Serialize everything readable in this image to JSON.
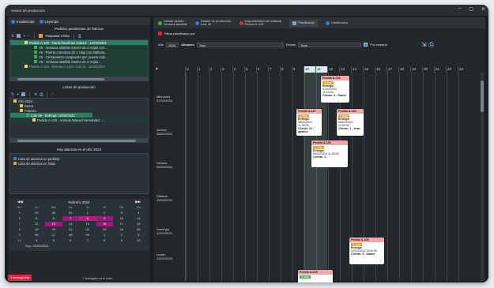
{
  "window": {
    "title": "Gestor de producción",
    "controls": [
      "–",
      "▢",
      "✕"
    ]
  },
  "left_tabs": [
    {
      "label": "Incidencias",
      "color": "#2f7bd6"
    },
    {
      "label": "Leyenda",
      "color": "#4f6bd1"
    }
  ],
  "orders_panel": {
    "title": "Pedidos pendientes de fabricar",
    "toolbar_label": "Traspasar a lista",
    "rows": [
      {
        "text": "Pedido A-100 · Daniel Martínez Gómez · 12/02/2024",
        "selected": true
      },
      {
        "text": "V5 - Ventana abatible interior de 2 Hojas con...",
        "selected": false
      },
      {
        "text": "V5 - Puerta corredera de 1 Hoja con Malloria...",
        "selected": false
      },
      {
        "text": "V5 - Cerramiento compuesto por: puerta más...",
        "selected": false
      },
      {
        "text": "V5 - Ventana abatible interior de 2 Hojas...",
        "selected": false
      },
      {
        "text": "Pedido A-101 · Brandon Lopez García · 12/02/2024",
        "selected": false
      }
    ]
  },
  "lists_panel": {
    "title": "Listas de producción",
    "rows": [
      {
        "text": "Año 2024",
        "indent": 0
      },
      {
        "text": "Enero",
        "indent": 1
      },
      {
        "text": "Febrero",
        "indent": 1
      },
      {
        "text": "Lote 39 - Entrega: 10/02/2024",
        "indent": 2,
        "selected": true
      },
      {
        "text": "Pedido A-100 · Antonio Manuel Hernández · ...",
        "indent": 3
      }
    ]
  },
  "alerts_panel": {
    "title": "Hay alarmas en el año 2024",
    "items": [
      {
        "text": "Lista de alarmas en pedidos",
        "color": "#2f7bd6"
      },
      {
        "text": "Lista de alarmas en listas",
        "color": "#f59b1b"
      }
    ]
  },
  "calendar": {
    "month_label": "Febrero 2024",
    "weekday_headers": [
      "Se.",
      "Lu",
      "Ma",
      "Mi",
      "Ju",
      "Vi",
      "Sá",
      "Do"
    ],
    "weeks": [
      [
        "5",
        "29",
        "30",
        "31",
        "1",
        "2",
        "3",
        "4"
      ],
      [
        "6",
        "5",
        "6",
        "7",
        "8",
        "9",
        "10",
        "11"
      ],
      [
        "7",
        "12",
        "13",
        "14",
        "15",
        "16",
        "17",
        "18"
      ],
      [
        "8",
        "19",
        "20",
        "21",
        "22",
        "23",
        "24",
        "25"
      ],
      [
        "9",
        "26",
        "27",
        "28",
        "29",
        "1",
        "2",
        "3"
      ],
      [
        "10",
        "4",
        "5",
        "6",
        "7",
        "8",
        "9",
        "10"
      ]
    ],
    "today_label": "Hoy: 16/02/2024"
  },
  "status": {
    "left": "1 entrega hoy",
    "center": "7 entregas en el mes"
  },
  "right_tabs": [
    {
      "label": "Detalle pedido",
      "sub": "Ventana abatible",
      "color": "#3db14c"
    },
    {
      "label": "Detalle de producción",
      "sub": "Lote 39",
      "color": "#2f7bd6"
    },
    {
      "label": "Disponibilidad del material",
      "sub": "Pedido A-109",
      "color": "#d9283b"
    },
    {
      "label": "Planificador",
      "sub": "",
      "color": "#8aa0b3",
      "active": true
    },
    {
      "label": "Distribución",
      "sub": "",
      "color": "#2f7bd6"
    }
  ],
  "filter_button": "Filtrar planificador por",
  "filters": {
    "year_label": "Año",
    "year": "2024",
    "warehouse_label": "Almacén",
    "warehouse": "Todo",
    "state_label": "Estado",
    "state": "Todo",
    "per_week": "Por semana"
  },
  "hours": [
    "0",
    "1",
    "2",
    "3",
    "4",
    "5",
    "6",
    "7",
    "8",
    "9",
    "10",
    "11",
    "12",
    "13",
    "14",
    "15",
    "16",
    "17",
    "18",
    "19",
    "20",
    "21",
    "22",
    "23"
  ],
  "days": [
    {
      "name": "Miércoles",
      "date": "07/02/2024"
    },
    {
      "name": "Jueves",
      "date": "08/02/2024"
    },
    {
      "name": "Viernes",
      "date": "09/02/2024"
    },
    {
      "name": "Sábado",
      "date": "10/02/2024"
    },
    {
      "name": "Domingo",
      "date": "11/02/2024"
    },
    {
      "name": "Lunes",
      "date": "12/02/2024"
    },
    {
      "name": "Martes",
      "date": "13/02/2024"
    }
  ],
  "orders": [
    {
      "title": "Pedido A-102",
      "badge": "0 días",
      "entrega": "Entrega:",
      "date": "07/02/2024 11:00:00",
      "client": "Cliente: 3 - Daniel"
    },
    {
      "title": "Pedido A-107",
      "badge": "0 días",
      "entrega": "Entrega:",
      "date": "08/02/2024 11:00:00",
      "client": "Cliente: 21 - Ignacio"
    },
    {
      "title": "Pedido A-106",
      "badge": "0 días",
      "entrega": "Entrega:",
      "date": "08/02/2024 12:00:00",
      "client": "Cliente: 1 - Juan"
    },
    {
      "title": "Pedido A-108",
      "badge": "0 días",
      "entrega": "Entrega:",
      "date": "09/02/2024 11:00:00",
      "client": "Cliente: 1 -"
    },
    {
      "title": "Pedido A-109",
      "badge": "0 días",
      "entrega": "Entrega:",
      "date": "12/02/2024 15:00:00",
      "client": "Cliente: 3 - Daniel"
    },
    {
      "title": "Pedido A-105",
      "badge": "0 días",
      "entrega": "",
      "date": "",
      "client": ""
    }
  ]
}
